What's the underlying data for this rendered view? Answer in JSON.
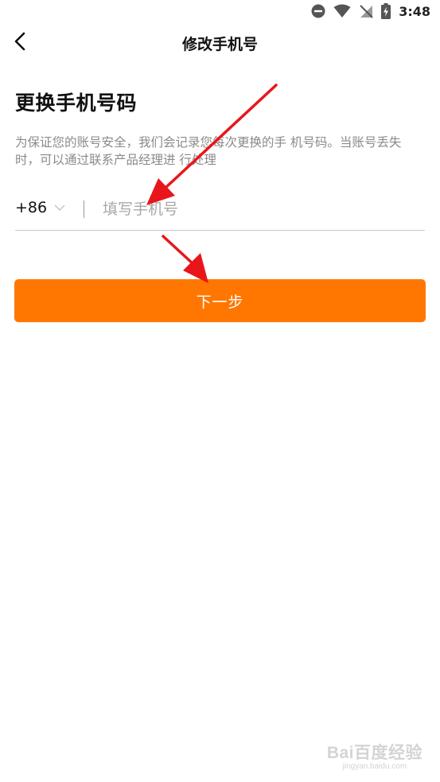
{
  "status_bar": {
    "time": "3:48",
    "icons": [
      "do-not-disturb-icon",
      "wifi-icon",
      "no-signal-icon",
      "battery-charging-icon"
    ]
  },
  "header": {
    "title": "修改手机号",
    "back_icon": "back-chevron-icon"
  },
  "section": {
    "title": "更换手机号码",
    "description": "为保证您的账号安全，我们会记录您每次更换的手 机号码。当账号丢失时，可以通过联系产品经理进 行处理"
  },
  "phone_input": {
    "country_code": "+86",
    "value": "",
    "placeholder": "填写手机号"
  },
  "next_button": {
    "label": "下一步"
  },
  "watermark": {
    "logo": "Bai百度经验",
    "url": "jingyan.baidu.com"
  },
  "colors": {
    "accent": "#ff7700",
    "annotation": "#e8161b",
    "muted_text": "#8a8a8a"
  }
}
